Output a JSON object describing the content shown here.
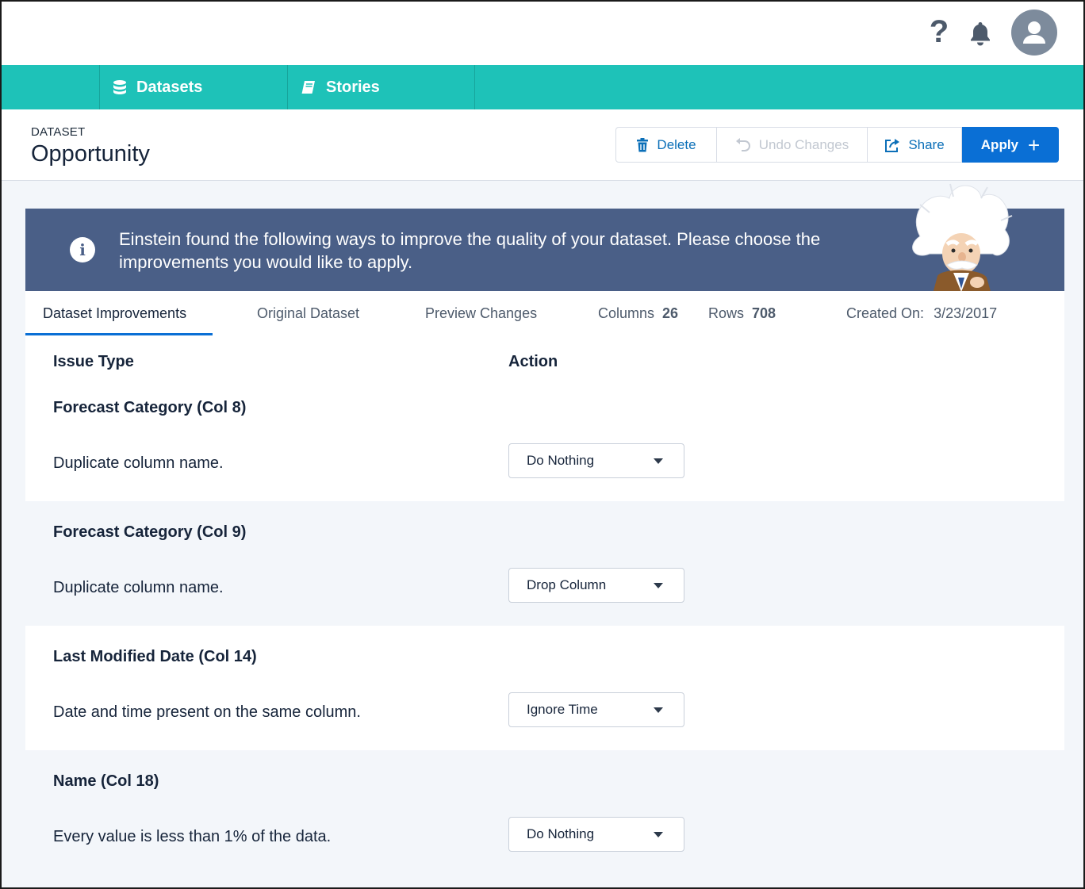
{
  "header": {
    "help_icon": "question-icon",
    "notifications_icon": "bell-icon",
    "avatar_icon": "user-icon"
  },
  "nav": {
    "tabs": [
      {
        "label": "Datasets",
        "icon": "database-icon"
      },
      {
        "label": "Stories",
        "icon": "book-icon"
      }
    ]
  },
  "page": {
    "eyebrow": "DATASET",
    "title": "Opportunity"
  },
  "actions": {
    "delete_label": "Delete",
    "undo_label": "Undo Changes",
    "share_label": "Share",
    "apply_label": "Apply"
  },
  "banner": {
    "text": "Einstein found the following ways to improve the quality of your dataset. Please choose the improvements you would like to apply."
  },
  "tabs": {
    "improvements": "Dataset Improvements",
    "original": "Original Dataset",
    "preview": "Preview Changes"
  },
  "stats": {
    "columns_label": "Columns",
    "columns_value": "26",
    "rows_label": "Rows",
    "rows_value": "708",
    "created_label": "Created On:",
    "created_value": "3/23/2017"
  },
  "table": {
    "issue_header": "Issue Type",
    "action_header": "Action",
    "issues": [
      {
        "title": "Forecast Category (Col 8)",
        "description": "Duplicate column name.",
        "action": "Do Nothing"
      },
      {
        "title": "Forecast Category (Col 9)",
        "description": "Duplicate column name.",
        "action": "Drop Column"
      },
      {
        "title": "Last Modified Date (Col 14)",
        "description": "Date and time present on the same column.",
        "action": "Ignore Time"
      },
      {
        "title": "Name (Col 18)",
        "description": "Every value is less than 1% of the data.",
        "action": "Do Nothing"
      }
    ]
  },
  "colors": {
    "nav": "#1ec2b8",
    "banner": "#4a5f87",
    "primary": "#0a6fd5"
  }
}
